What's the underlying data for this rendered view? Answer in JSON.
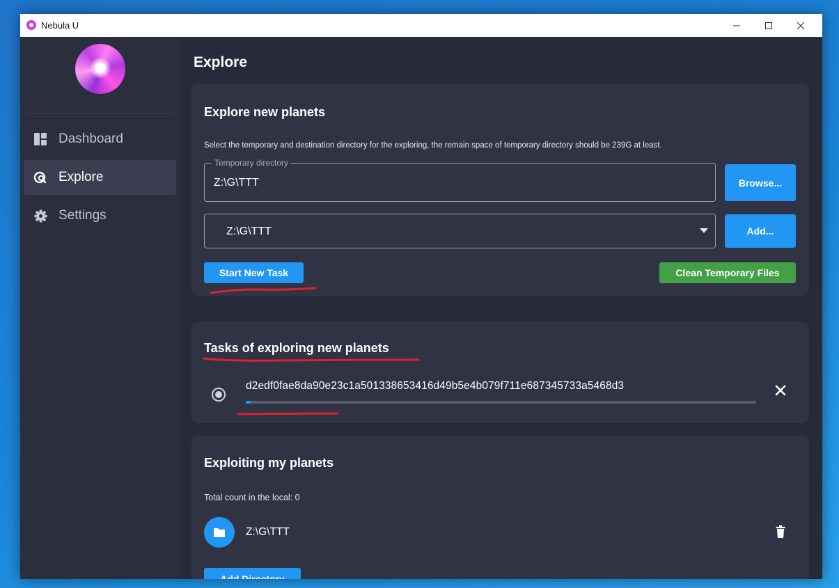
{
  "window": {
    "title": "Nebula U"
  },
  "sidebar": {
    "items": [
      {
        "label": "Dashboard",
        "icon": "dashboard-icon",
        "active": false
      },
      {
        "label": "Explore",
        "icon": "explore-icon",
        "active": true
      },
      {
        "label": "Settings",
        "icon": "gear-icon",
        "active": false
      }
    ]
  },
  "main": {
    "title": "Explore"
  },
  "explore_card": {
    "title": "Explore new planets",
    "hint": "Select the temporary and destination directory for the exploring, the remain space of temporary directory should be 239G at least.",
    "temp_dir": {
      "legend": "Temporary directory",
      "value": "Z:\\G\\TTT"
    },
    "browse_label": "Browse...",
    "dest_select": {
      "value": "Z:\\G\\TTT"
    },
    "add_label": "Add...",
    "start_label": "Start New Task",
    "clean_label": "Clean Temporary Files"
  },
  "tasks_card": {
    "title": "Tasks of exploring new planets",
    "tasks": [
      {
        "id": "d2edf0fae8da90e23c1a501338653416d49b5e4b079f711e687345733a5468d3",
        "progress": 0.01
      }
    ]
  },
  "exploit_card": {
    "title": "Exploiting my planets",
    "count_text": "Total count in the local: 0",
    "directories": [
      {
        "path": "Z:\\G\\TTT"
      }
    ],
    "add_dir_label": "Add Directory"
  },
  "colors": {
    "accent": "#2196f3",
    "success": "#43a047",
    "annotation": "#e0202a",
    "background": "#262a39"
  }
}
